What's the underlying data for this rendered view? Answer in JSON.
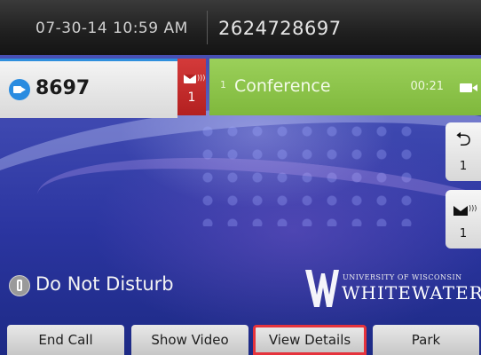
{
  "header": {
    "datetime": "07-30-14 10:59 AM",
    "phone_number": "2624728697"
  },
  "line": {
    "icon": "video-call-icon",
    "extension": "8697",
    "voicemail_count": "1"
  },
  "call": {
    "label": "Conference",
    "sub": "1",
    "duration": "00:21",
    "icon": "video-camera-icon"
  },
  "side_keys": [
    {
      "icon": "call-forward-icon",
      "count": "1"
    },
    {
      "icon": "voicemail-icon",
      "count": "1"
    }
  ],
  "status": {
    "dnd_label": "Do Not Disturb"
  },
  "logo": {
    "top_text": "UNIVERSITY OF WISCONSIN",
    "main_text": "WHITEWATER"
  },
  "softkeys": [
    {
      "label": "End Call"
    },
    {
      "label": "Show Video"
    },
    {
      "label": "View Details"
    },
    {
      "label": "Park"
    }
  ],
  "colors": {
    "accent_line": "#2a8ce0",
    "voicemail_badge": "#c42a2a",
    "conference_key": "#8cc44a",
    "selected_softkey_border": "#e5333c"
  }
}
